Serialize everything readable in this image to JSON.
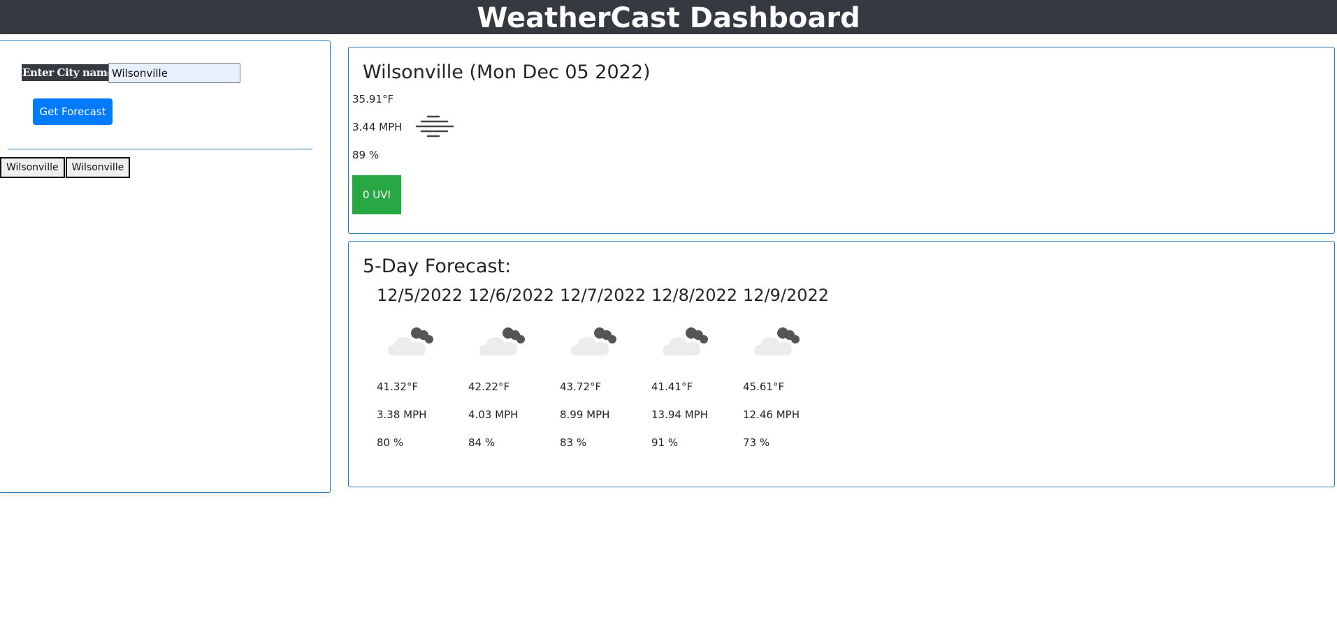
{
  "header": {
    "title": "WeatherCast Dashboard"
  },
  "search": {
    "label": "Enter City name",
    "value": "Wilsonville",
    "button_label": "Get Forecast"
  },
  "history": [
    "Wilsonville",
    "Wilsonville"
  ],
  "current": {
    "title": "Wilsonville (Mon Dec 05 2022)",
    "temp": "35.91°F",
    "wind": "3.44 MPH",
    "humidity": "89 %",
    "uvi": "0 UVI",
    "icon": "mist-icon"
  },
  "forecast": {
    "title": "5-Day Forecast:",
    "days": [
      {
        "date": "12/5/2022",
        "temp": "41.32°F",
        "wind": "3.38 MPH",
        "humidity": "80 %",
        "icon": "cloud-icon"
      },
      {
        "date": "12/6/2022",
        "temp": "42.22°F",
        "wind": "4.03 MPH",
        "humidity": "84 %",
        "icon": "cloud-icon"
      },
      {
        "date": "12/7/2022",
        "temp": "43.72°F",
        "wind": "8.99 MPH",
        "humidity": "83 %",
        "icon": "cloud-icon"
      },
      {
        "date": "12/8/2022",
        "temp": "41.41°F",
        "wind": "13.94 MPH",
        "humidity": "91 %",
        "icon": "cloud-icon"
      },
      {
        "date": "12/9/2022",
        "temp": "45.61°F",
        "wind": "12.46 MPH",
        "humidity": "73 %",
        "icon": "cloud-icon"
      }
    ]
  },
  "colors": {
    "header_bg": "#343a40",
    "accent": "#007bff",
    "uvi_good": "#28a745",
    "card_border": "#2b7bb9"
  }
}
